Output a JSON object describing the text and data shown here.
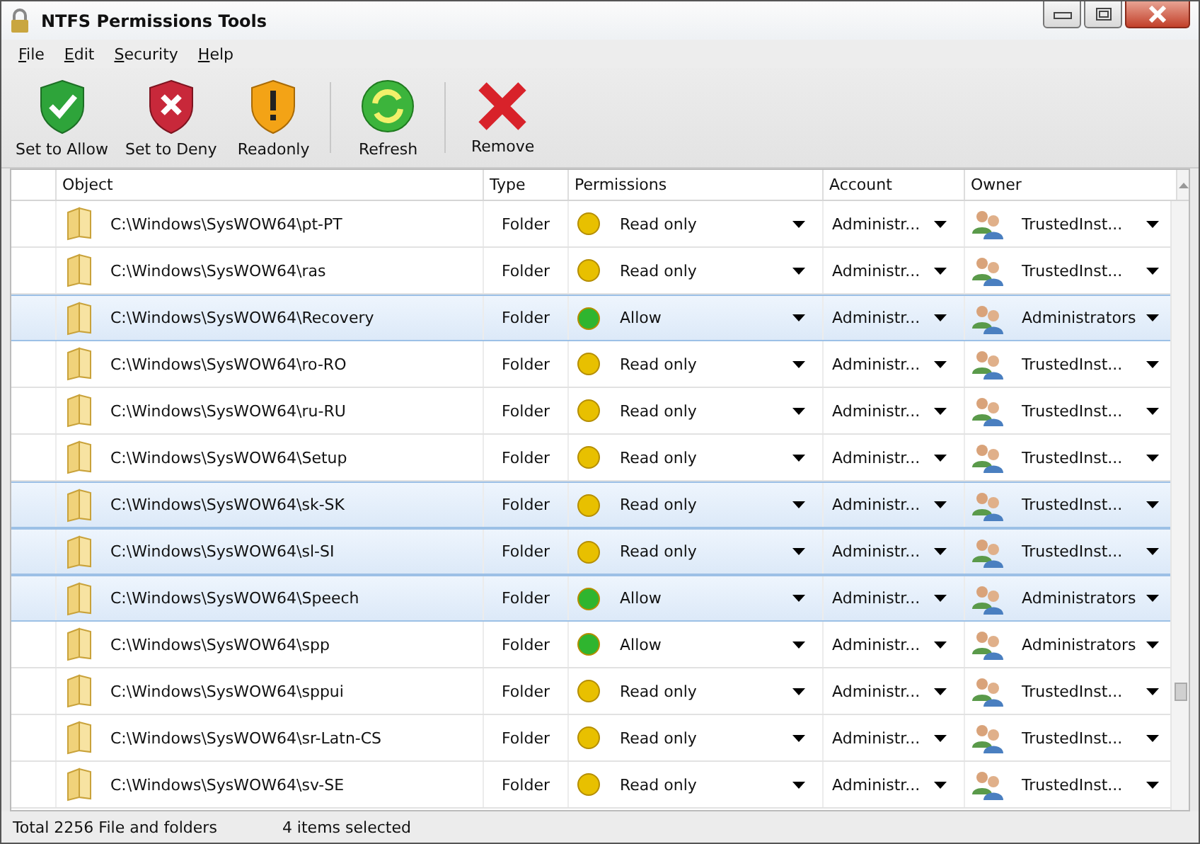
{
  "window": {
    "title": "NTFS Permissions Tools"
  },
  "menu": [
    "File",
    "Edit",
    "Security",
    "Help"
  ],
  "toolbar": [
    {
      "label": "Set to Allow",
      "kind": "allow"
    },
    {
      "label": "Set to Deny",
      "kind": "deny"
    },
    {
      "label": "Readonly",
      "kind": "readonly"
    },
    {
      "label": "Refresh",
      "kind": "refresh"
    },
    {
      "label": "Remove",
      "kind": "remove"
    }
  ],
  "table": {
    "columns": [
      "Object",
      "Type",
      "Permissions",
      "Account",
      "Owner"
    ],
    "rows": [
      {
        "object": "C:\\Windows\\SysWOW64\\pt-PT",
        "type": "Folder",
        "permission": "Read only",
        "color": "#e8c000",
        "account": "Administr...",
        "owner": "TrustedInst...",
        "selected": false
      },
      {
        "object": "C:\\Windows\\SysWOW64\\ras",
        "type": "Folder",
        "permission": "Read only",
        "color": "#e8c000",
        "account": "Administr...",
        "owner": "TrustedInst...",
        "selected": false
      },
      {
        "object": "C:\\Windows\\SysWOW64\\Recovery",
        "type": "Folder",
        "permission": "Allow",
        "color": "#2fb52f",
        "account": "Administr...",
        "owner": "Administrators",
        "selected": true
      },
      {
        "object": "C:\\Windows\\SysWOW64\\ro-RO",
        "type": "Folder",
        "permission": "Read only",
        "color": "#e8c000",
        "account": "Administr...",
        "owner": "TrustedInst...",
        "selected": false
      },
      {
        "object": "C:\\Windows\\SysWOW64\\ru-RU",
        "type": "Folder",
        "permission": "Read only",
        "color": "#e8c000",
        "account": "Administr...",
        "owner": "TrustedInst...",
        "selected": false
      },
      {
        "object": "C:\\Windows\\SysWOW64\\Setup",
        "type": "Folder",
        "permission": "Read only",
        "color": "#e8c000",
        "account": "Administr...",
        "owner": "TrustedInst...",
        "selected": false
      },
      {
        "object": "C:\\Windows\\SysWOW64\\sk-SK",
        "type": "Folder",
        "permission": "Read only",
        "color": "#e8c000",
        "account": "Administr...",
        "owner": "TrustedInst...",
        "selected": true
      },
      {
        "object": "C:\\Windows\\SysWOW64\\sl-SI",
        "type": "Folder",
        "permission": "Read only",
        "color": "#e8c000",
        "account": "Administr...",
        "owner": "TrustedInst...",
        "selected": true
      },
      {
        "object": "C:\\Windows\\SysWOW64\\Speech",
        "type": "Folder",
        "permission": "Allow",
        "color": "#2fb52f",
        "account": "Administr...",
        "owner": "Administrators",
        "selected": true
      },
      {
        "object": "C:\\Windows\\SysWOW64\\spp",
        "type": "Folder",
        "permission": "Allow",
        "color": "#2fb52f",
        "account": "Administr...",
        "owner": "Administrators",
        "selected": false
      },
      {
        "object": "C:\\Windows\\SysWOW64\\sppui",
        "type": "Folder",
        "permission": "Read only",
        "color": "#e8c000",
        "account": "Administr...",
        "owner": "TrustedInst...",
        "selected": false
      },
      {
        "object": "C:\\Windows\\SysWOW64\\sr-Latn-CS",
        "type": "Folder",
        "permission": "Read only",
        "color": "#e8c000",
        "account": "Administr...",
        "owner": "TrustedInst...",
        "selected": false
      },
      {
        "object": "C:\\Windows\\SysWOW64\\sv-SE",
        "type": "Folder",
        "permission": "Read only",
        "color": "#e8c000",
        "account": "Administr...",
        "owner": "TrustedInst...",
        "selected": false
      }
    ]
  },
  "status_bar": [
    "Total 2256 File and folders",
    "4 items selected"
  ]
}
